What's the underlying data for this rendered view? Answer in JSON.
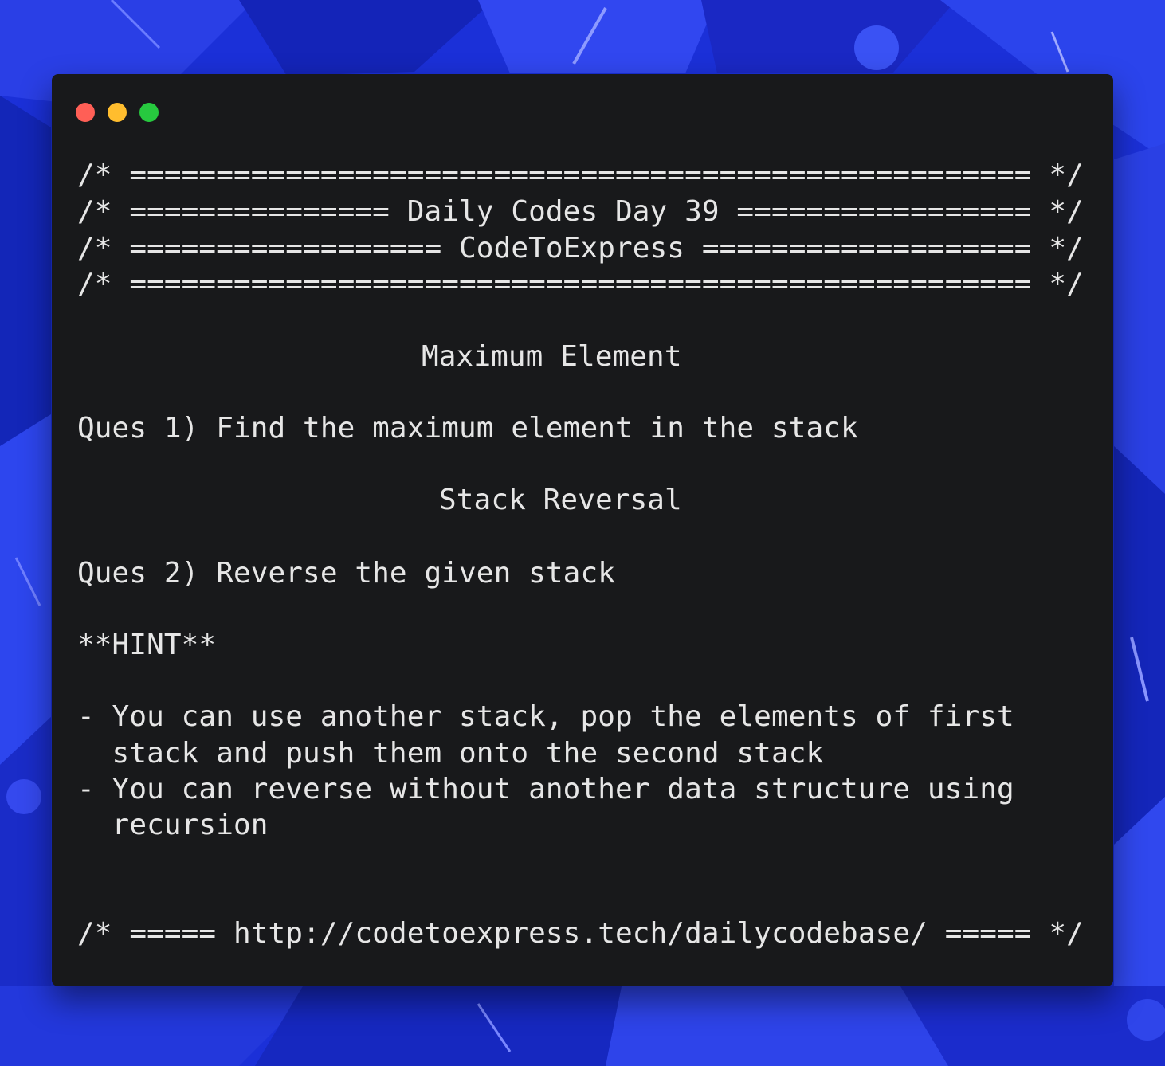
{
  "window": {
    "controls": {
      "close_color": "#ff5f56",
      "minimize_color": "#ffbd2e",
      "maximize_color": "#27c93f"
    }
  },
  "code": {
    "header_line_1": "/* ==================================================== */",
    "header_line_2": "/* =============== Daily Codes Day 39 ================= */",
    "header_line_3": "/* ================== CodeToExpress =================== */",
    "header_line_4": "/* ==================================================== */",
    "title_1": "Maximum Element",
    "question_1": "Ques 1) Find the maximum element in the stack",
    "title_2": "Stack Reversal",
    "question_2": "Ques 2) Reverse the given stack",
    "hint_label": "**HINT**",
    "hint_1_line_1": "- You can use another stack, pop the elements of first",
    "hint_1_line_2": "  stack and push them onto the second stack",
    "hint_2_line_1": "- You can reverse without another data structure using",
    "hint_2_line_2": "  recursion",
    "footer": "/* ===== http://codetoexpress.tech/dailycodebase/ ===== */"
  },
  "colors": {
    "window_background": "#18191b",
    "text": "#e6e6e6",
    "backdrop": "#1a2fd6"
  }
}
